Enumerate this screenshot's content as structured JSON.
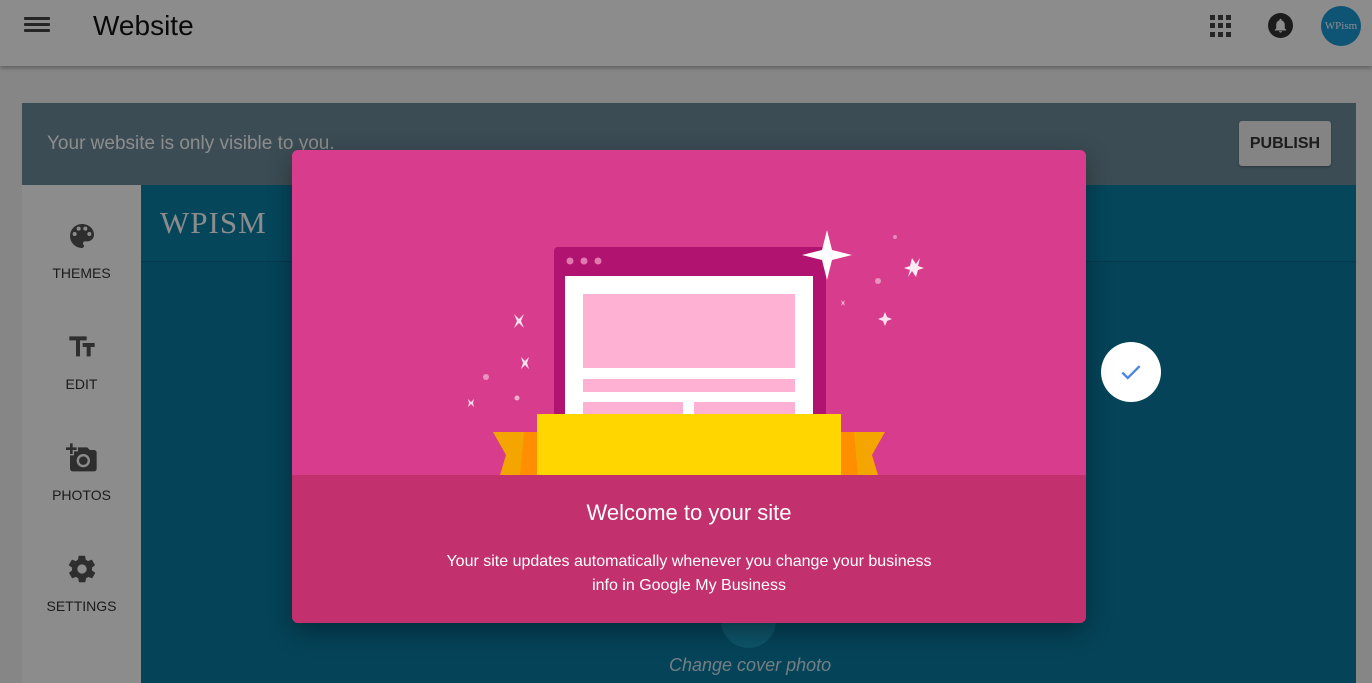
{
  "app": {
    "title": "Website",
    "avatar_text": "WPism",
    "brand_color": "#1b9ad6"
  },
  "banner": {
    "text": "Your website is only visible to you.",
    "publish_label": "PUBLISH"
  },
  "sidebar": {
    "items": [
      {
        "label": "THEMES",
        "icon": "palette-icon"
      },
      {
        "label": "EDIT",
        "icon": "text-format-icon"
      },
      {
        "label": "PHOTOS",
        "icon": "add-photo-icon"
      },
      {
        "label": "SETTINGS",
        "icon": "gear-icon"
      }
    ]
  },
  "preview": {
    "brand_name": "WPISM",
    "cover_label": "Change cover photo",
    "theme_color": "#0a7aa0"
  },
  "dialog": {
    "title": "Welcome to your site",
    "text_line1": "Your site updates automatically whenever you change your business",
    "text_line2": "info in Google My Business",
    "art_color": "#d83c8c",
    "body_color": "#c2306d"
  }
}
